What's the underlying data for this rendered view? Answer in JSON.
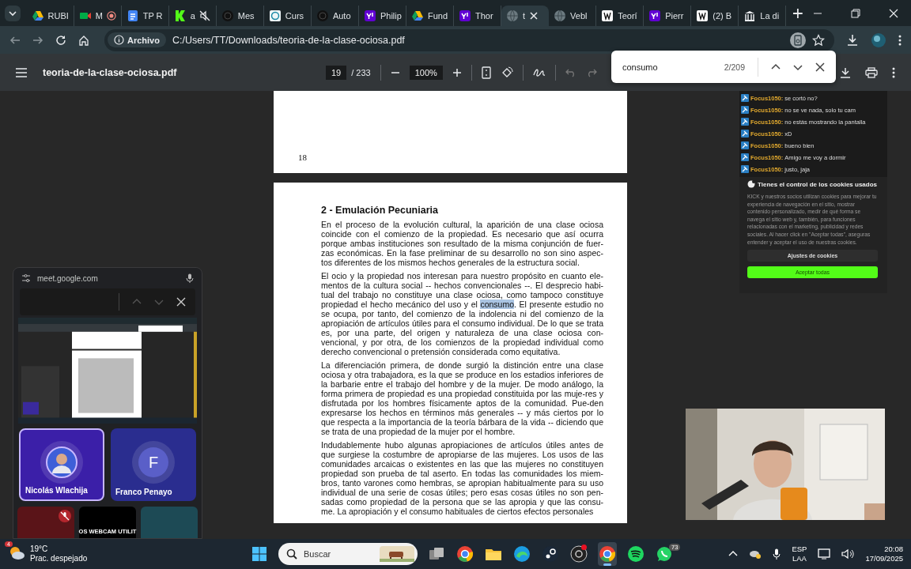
{
  "browser": {
    "tabs": [
      {
        "kind": "triangle",
        "label": "RUBI",
        "selected": false,
        "recording": false,
        "muted": false
      },
      {
        "kind": "camera",
        "label": "M",
        "selected": false,
        "recording": true,
        "muted": false
      },
      {
        "kind": "doc",
        "label": "TP R",
        "selected": false,
        "recording": false,
        "muted": false
      },
      {
        "kind": "green",
        "label": "a",
        "selected": false,
        "recording": false,
        "muted": true
      },
      {
        "kind": "dark",
        "label": "Mes",
        "selected": false,
        "recording": false,
        "muted": false
      },
      {
        "kind": "ring",
        "label": "Curs",
        "selected": false,
        "recording": false,
        "muted": false
      },
      {
        "kind": "dark",
        "label": "Auto",
        "selected": false,
        "recording": false,
        "muted": false
      },
      {
        "kind": "purple",
        "label": "Philip",
        "selected": false,
        "recording": false,
        "muted": false
      },
      {
        "kind": "triangle",
        "label": "Fund",
        "selected": false,
        "recording": false,
        "muted": false
      },
      {
        "kind": "purple",
        "label": "Thor",
        "selected": false,
        "recording": false,
        "muted": false
      },
      {
        "kind": "globe",
        "label": "t",
        "selected": true,
        "recording": false,
        "muted": false
      },
      {
        "kind": "globe",
        "label": "Vebl",
        "selected": false,
        "recording": false,
        "muted": false
      },
      {
        "kind": "white",
        "label": "Teorí",
        "selected": false,
        "recording": false,
        "muted": false
      },
      {
        "kind": "purple",
        "label": "Pierr",
        "selected": false,
        "recording": false,
        "muted": false
      },
      {
        "kind": "white",
        "label": "(2) B",
        "selected": false,
        "recording": false,
        "muted": false
      },
      {
        "kind": "columns",
        "label": "La di",
        "selected": false,
        "recording": false,
        "muted": false
      }
    ],
    "address": {
      "chip": "Archivo",
      "url": "C:/Users/TT/Downloads/teoria-de-la-clase-ociosa.pdf"
    }
  },
  "pdf_toolbar": {
    "title": "teoria-de-la-clase-ociosa.pdf",
    "page": "19",
    "page_total": "/ 233",
    "zoom": "100%"
  },
  "find_bar": {
    "query": "consumo",
    "count": "2/209"
  },
  "document": {
    "previous_page_number": "18",
    "heading": "2 - Emulación Pecuniaria",
    "paragraphs": [
      [
        {
          "text": "En el proceso de la evolución cultural, la aparición de una clase ociosa coincide con el comienzo de la propiedad. Es necesario que así ocurra porque ambas instituciones son resultado de la misma conjunción de fuer-zas económicas. En la fase preliminar de su desarrollo no son sino aspec-tos diferentes de los mismos hechos generales de la estructura social.",
          "highlighted": false
        }
      ],
      [
        {
          "text": "El ocio y la propiedad nos interesan para nuestro propósito en cuanto ele-mentos de la cultura social -- hechos convencionales --. El desprecio habi-tual del trabajo no constituye una clase ociosa, como tampoco constituye propiedad el hecho mecánico del uso y el ",
          "highlighted": false
        },
        {
          "text": "consumo",
          "highlighted": true
        },
        {
          "text": ". El presente estudio no se ocupa, por tanto, del comienzo de la indolencia ni del comienzo de la apropiación de artículos útiles para el consumo individual. De lo que se trata es, por una parte, del origen y naturaleza de una clase ociosa con-vencional, y por otra, de los comienzos de la propiedad individual como derecho convencional o pretensión considerada como equitativa.",
          "highlighted": false
        }
      ],
      [
        {
          "text": "La diferenciación primera, de donde surgió la distinción entre una clase ociosa y otra trabajadora, es la que se produce en los estadios inferiores de la barbarie entre el trabajo del hombre y de la mujer. De modo análogo, la forma primera de propiedad es una propiedad constituida por las muje-res y disfrutada por los hombres físicamente aptos de la comunidad. Pue-den expresarse los hechos en términos más generales -- y más ciertos por lo que respecta a la importancia de la teoría bárbara de la vida -- diciendo que se trata de una propiedad de la mujer por el hombre.",
          "highlighted": false
        }
      ],
      [
        {
          "text": "Indudablemente hubo algunas apropiaciones de artículos útiles antes de que surgiese la costumbre de apropiarse de las mujeres. Los usos de las comunidades arcaicas o existentes en las que las mujeres no constituyen propiedad son prueba de tal aserto. En todas las comunidades los miem-bros, tanto varones como hembras, se apropian habitualmente para su uso individual de una serie de cosas útiles; pero esas cosas útiles no son pen-sadas como propiedad de la persona que se las apropia y que las consu-me. La apropiación y el consumo habituales de ciertos efectos personales",
          "highlighted": false
        }
      ]
    ]
  },
  "meet_window": {
    "url": "meet.google.com",
    "participants": [
      {
        "name": "Nicolás Wlachija",
        "selected": true
      },
      {
        "kind": "initial",
        "initial": "F",
        "name": "Franco Penayo",
        "selected": false
      }
    ],
    "tiles": [
      {
        "kind": "muted"
      },
      {
        "kind": "label",
        "label": "OS WEBCAM UTILIT"
      },
      {
        "kind": "plain"
      }
    ]
  },
  "chat": {
    "messages": [
      {
        "user": "Focus1050:",
        "text": "se cortó no?"
      },
      {
        "user": "Focus1050:",
        "text": "no se ve nada, solo tu cam"
      },
      {
        "user": "Focus1050:",
        "text": "no estás mostrando la pantalla"
      },
      {
        "user": "Focus1050:",
        "text": "xD"
      },
      {
        "user": "Focus1050:",
        "text": "bueno bien"
      },
      {
        "user": "Focus1050:",
        "text": "Amigo me voy a dormir"
      },
      {
        "user": "Focus1050:",
        "text": "justo, jaja"
      }
    ]
  },
  "cookie_dialog": {
    "title": "Tienes el control de los cookies usados",
    "body": "KICK y nuestros socios utilizan cookies para mejorar tu experiencia de navegación en el sitio, mostrar contenido personalizado, medir de qué forma se navega el sitio web y, también, para funciones relacionadas con el marketing, publicidad y redes sociales. Al hacer click en \"Aceptar todas\", aseguras entender y aceptar el uso de nuestras cookies.",
    "buttons": [
      {
        "kind": "secondary",
        "label": "Ajustes de cookies"
      },
      {
        "kind": "primary",
        "label": "Aceptar todas"
      }
    ]
  },
  "taskbar": {
    "weather": {
      "badge": "4",
      "temperature": "19°C",
      "condition": "Prac. despejado"
    },
    "search": {
      "placeholder": "Buscar"
    },
    "apps": [
      {
        "kind": "start",
        "active": false,
        "notification": false
      },
      {
        "kind": "task-view",
        "active": false,
        "notification": false
      },
      {
        "kind": "chrome",
        "active": false,
        "notification": false
      },
      {
        "kind": "folder",
        "active": false,
        "notification": false
      },
      {
        "kind": "edge",
        "active": false,
        "notification": false
      },
      {
        "kind": "steam",
        "active": false,
        "notification": false
      },
      {
        "kind": "recorder",
        "active": false,
        "notification": true
      },
      {
        "kind": "chrome",
        "active": true,
        "notification": false
      },
      {
        "kind": "spotify",
        "active": false,
        "notification": false
      },
      {
        "kind": "whatsapp",
        "active": false,
        "notification": false,
        "badge": "73"
      }
    ],
    "language": "ESP",
    "region": "LAA",
    "time": "20:08",
    "date": "17/09/2025"
  }
}
